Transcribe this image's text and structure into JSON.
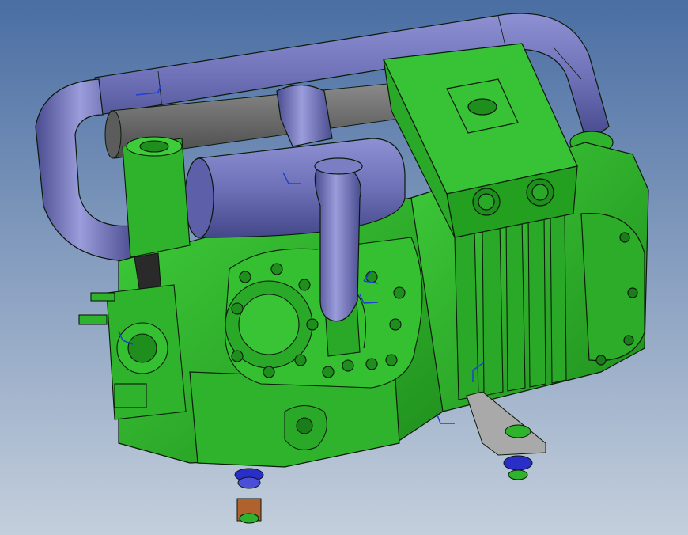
{
  "scene": {
    "background_top": "#4a6ea3",
    "background_bottom": "#c4cfdc",
    "compressor_body_color": "#2fb32c",
    "compressor_shadow_color": "#1a7d1a",
    "compressor_highlight_color": "#5fd85a",
    "pipe_color": "#6f71b8",
    "pipe_highlight_color": "#a7a9e0",
    "pipe_dark_color": "#45478a",
    "gray_pipe_color": "#6d6d6d",
    "outline_color": "#0a1a0a",
    "triad_color": "#1f3fd8",
    "mount_blue_color": "#2a2ec9",
    "mount_brown_color": "#b0622e",
    "bracket_color": "#a9a9a9"
  },
  "icons": {
    "triad": "coordinate-triad-icon",
    "logo": "logo-plate-icon"
  }
}
